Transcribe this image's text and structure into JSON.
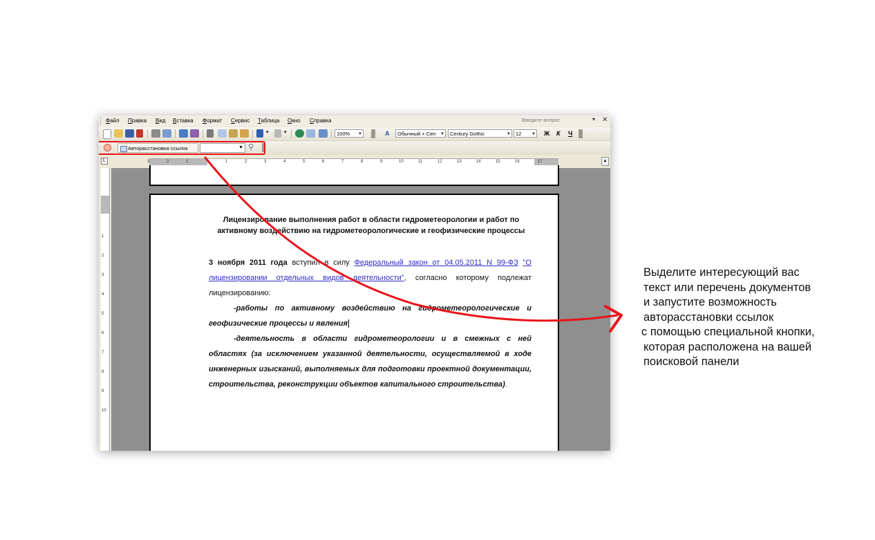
{
  "menu": {
    "items": [
      "Файл",
      "Правка",
      "Вид",
      "Вставка",
      "Формат",
      "Сервис",
      "Таблица",
      "Окно",
      "Справка"
    ],
    "help_placeholder": "Введите вопрос"
  },
  "toolbar": {
    "zoom": "100%",
    "style": "Обычный + Cen",
    "font": "Century Gothic",
    "font_size": "12",
    "bold": "Ж",
    "italic": "К",
    "underline": "Ч"
  },
  "search_toolbar": {
    "autolink_button": "Авторасстановка ссылок"
  },
  "ruler": {
    "labels": [
      "3",
      "2",
      "1",
      "1",
      "2",
      "3",
      "4",
      "5",
      "6",
      "7",
      "8",
      "9",
      "10",
      "11",
      "12",
      "13",
      "14",
      "15",
      "16",
      "17"
    ],
    "vertical_labels": [
      "1",
      "2",
      "3",
      "4",
      "5",
      "6",
      "7",
      "8",
      "9",
      "10"
    ]
  },
  "document": {
    "title": "Лицензирование выполнения работ в области гидрометеорологии и работ по активному воздействию на гидрометеорологические и геофизические процессы",
    "p1_date": "3 ноября 2011 года",
    "p1_text1": " вступил в силу ",
    "p1_link1": "Федеральный закон от 04.05.2011 N 99-ФЗ",
    "p1_link2": "\"О лицензировании отдельных видов деятельности\"",
    "p1_text2": ", согласно которому подлежат лицензированию:",
    "item1": "-работы по активному воздействию на гидрометеорологические и геофизические процессы и явления",
    "item2": "-деятельность в области гидрометеорологии и в смежных с ней областях (за исключением указанной деятельности, осуществляемой в ходе инженерных изысканий, выполняемых для подготовки проектной документации, строительства, реконструкции объектов капитального строительства)",
    "item2_end": "."
  },
  "annotation": {
    "lines": [
      "Выделите интересующий вас",
      "текст или перечень документов",
      "и запустите возможность",
      "авторасстановки ссылок",
      "с помощью  специальной кнопки,",
      "которая расположена на вашей",
      "поисковой панели"
    ]
  },
  "colors": {
    "highlight_red": "#e8141b",
    "link_blue": "#2d2dcc"
  }
}
